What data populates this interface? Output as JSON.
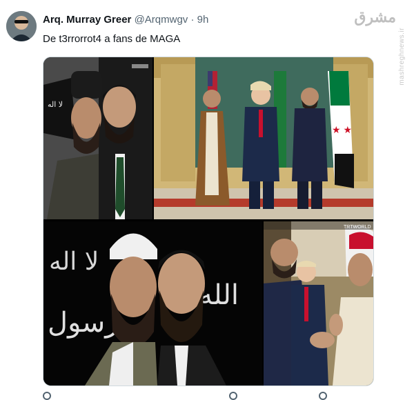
{
  "tweet": {
    "display_name": "Arq. Murray Greer",
    "handle": "@Arqmwgv",
    "separator": "·",
    "time": "9h",
    "text": "De t3rrorrot4 a fans de MAGA"
  },
  "watermark": {
    "logo": "مشرق",
    "url": "mashreghnews.ir"
  },
  "media": {
    "panel_1_label": "",
    "panel_4_label": "TRTWORLD"
  },
  "colors": {
    "text_primary": "#0f1419",
    "text_secondary": "#536471",
    "border": "#cfd9de"
  }
}
